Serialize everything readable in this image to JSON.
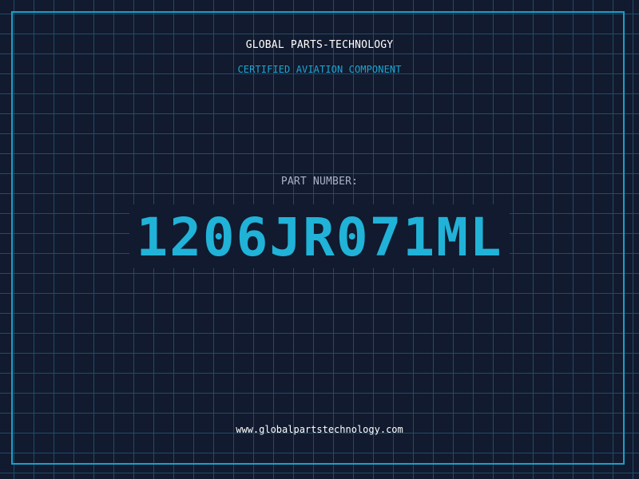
{
  "header": {
    "company": "GLOBAL PARTS-TECHNOLOGY",
    "subtitle": "CERTIFIED AVIATION COMPONENT"
  },
  "part": {
    "label": "PART NUMBER:",
    "number": "1206JR071ML"
  },
  "footer": {
    "website": "www.globalpartstechnology.com"
  },
  "colors": {
    "background": "#111a2e",
    "grid": "#1f4d68",
    "accent": "#21b2d8",
    "label": "#a9b3c6",
    "text": "#ffffff"
  }
}
